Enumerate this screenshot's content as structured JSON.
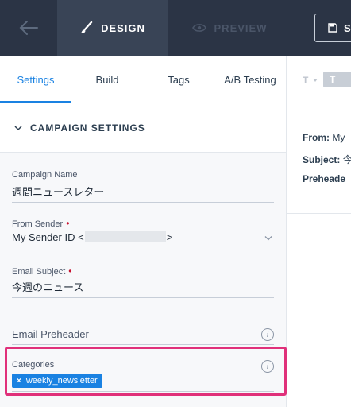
{
  "topbar": {
    "design_label": "DESIGN",
    "preview_label": "PREVIEW",
    "save_label": "S"
  },
  "subtabs": [
    {
      "label": "Settings",
      "active": true
    },
    {
      "label": "Build",
      "active": false
    },
    {
      "label": "Tags",
      "active": false
    },
    {
      "label": "A/B Testing",
      "active": false
    }
  ],
  "section": {
    "title": "CAMPAIGN SETTINGS"
  },
  "fields": {
    "campaign_name": {
      "label": "Campaign Name",
      "value": "週間ニュースレター"
    },
    "from_sender": {
      "label": "From Sender",
      "required_mark": "•",
      "value_prefix": "My Sender ID <",
      "value_suffix": ">"
    },
    "email_subject": {
      "label": "Email Subject",
      "required_mark": "•",
      "value": "今週のニュース"
    },
    "email_preheader": {
      "label": "Email Preheader",
      "value": ""
    },
    "categories": {
      "label": "Categories",
      "tags": [
        "weekly_newsletter"
      ]
    }
  },
  "preview": {
    "from_label": "From:",
    "from_value": "My",
    "subject_label": "Subject:",
    "subject_value": "今",
    "preheader_label": "Preheade"
  },
  "colors": {
    "accent": "#1a82e2",
    "topbar": "#2b3445",
    "highlight": "#e0307a",
    "required": "#c8102e"
  }
}
